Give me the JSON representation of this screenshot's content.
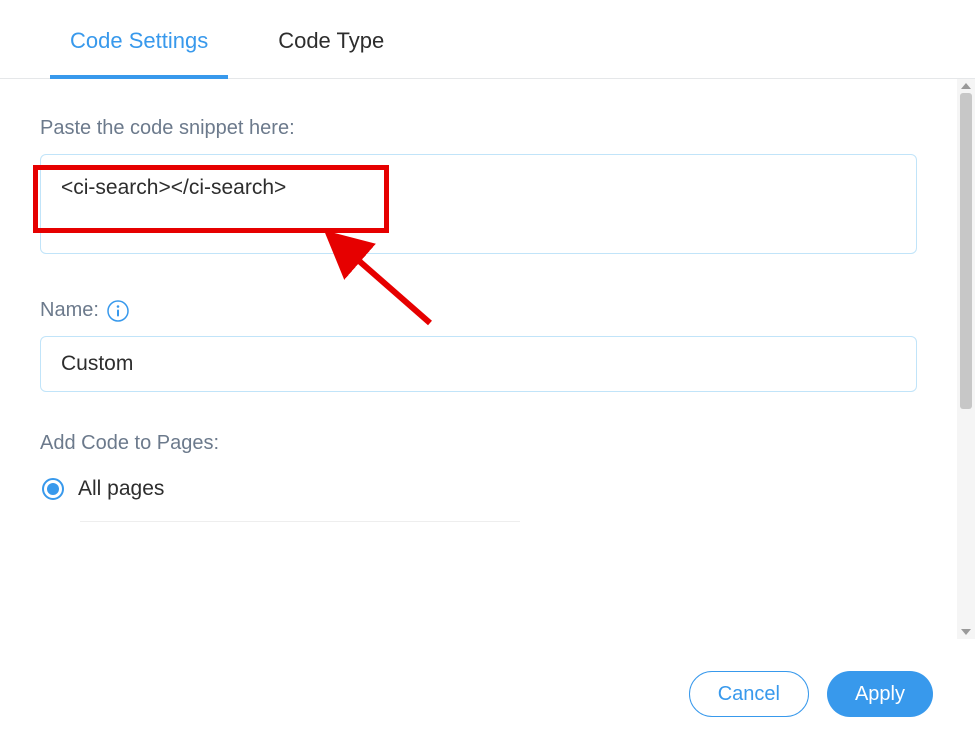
{
  "tabs": {
    "code_settings": "Code Settings",
    "code_type": "Code Type"
  },
  "form": {
    "snippet_label": "Paste the code snippet here:",
    "snippet_value": "<ci-search></ci-search>",
    "name_label": "Name:",
    "name_value": "Custom",
    "pages_label": "Add Code to Pages:",
    "radio_all_pages": "All pages"
  },
  "footer": {
    "cancel": "Cancel",
    "apply": "Apply"
  }
}
